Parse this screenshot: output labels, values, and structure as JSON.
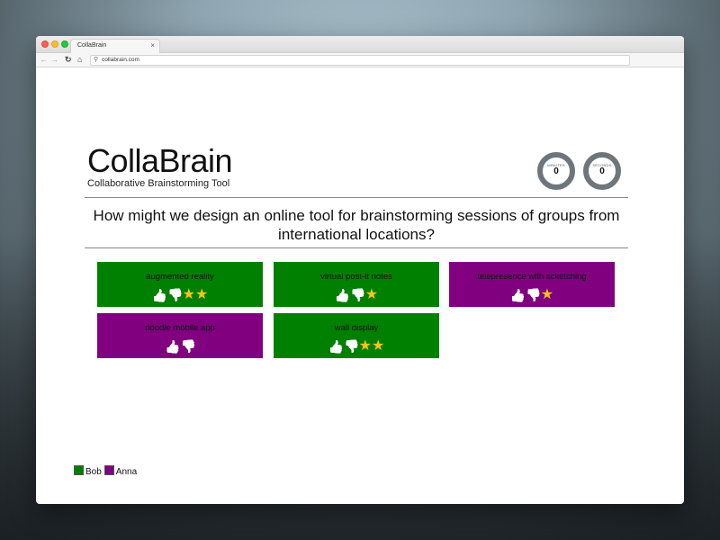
{
  "browser": {
    "tab_title": "CollaBrain",
    "tab_close": "×",
    "url": "collabrain.com",
    "icons": [
      "back-arrow-icon",
      "forward-arrow-icon",
      "reload-icon",
      "home-icon",
      "search-icon"
    ]
  },
  "header": {
    "title": "CollaBrain",
    "subtitle": "Collaborative Brainstorming Tool"
  },
  "timers": {
    "minutes_label": "MINUTES",
    "minutes_value": "0",
    "seconds_label": "SECONDS",
    "seconds_value": "0"
  },
  "question": "How might we design an online tool for brainstorming sessions of groups from international locations?",
  "colors": {
    "bob": "#008000",
    "anna": "#800080",
    "star": "#f5c518",
    "timer_ring": "#6e767c"
  },
  "ideas": [
    {
      "text": "augmented reality",
      "owner": "Bob",
      "stars": "★★"
    },
    {
      "text": "virtual post-it notes",
      "owner": "Bob",
      "stars": "★"
    },
    {
      "text": "telepresence with scketching",
      "owner": "Anna",
      "stars": "★"
    },
    {
      "text": "doodle mobile app",
      "owner": "Anna",
      "stars": ""
    },
    {
      "text": "wall display",
      "owner": "Bob",
      "stars": "★★"
    }
  ],
  "legend": [
    {
      "name": "Bob"
    },
    {
      "name": "Anna"
    }
  ]
}
